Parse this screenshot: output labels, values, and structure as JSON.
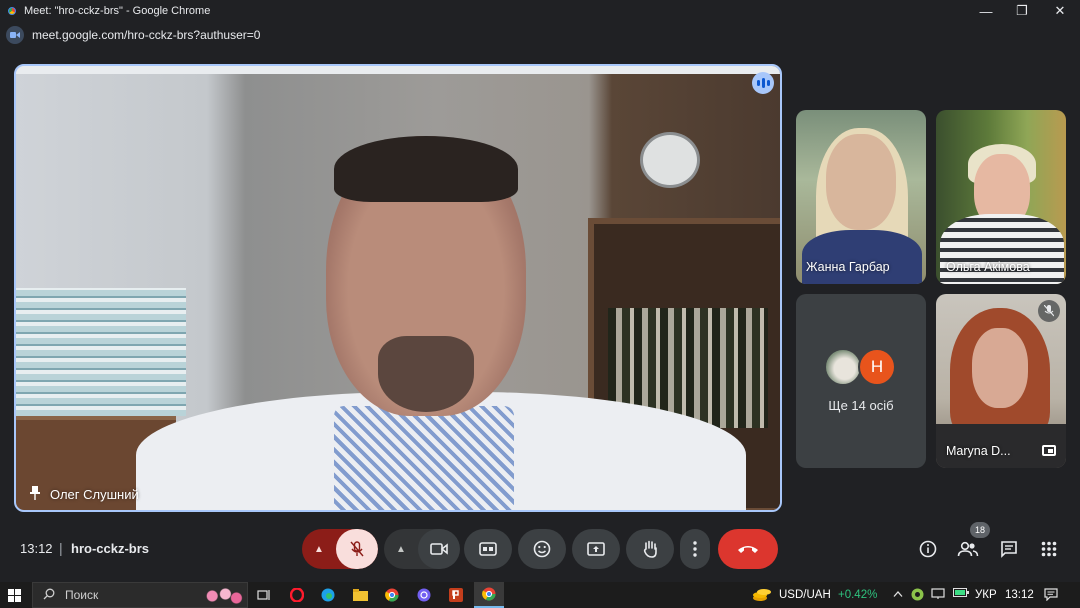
{
  "window": {
    "title": "Meet: \"hro-cckz-brs\" - Google Chrome",
    "minimize": "—",
    "maximize": "❐",
    "close": "✕"
  },
  "address": {
    "url": "meet.google.com/hro-cckz-brs?authuser=0",
    "site_icon": "meet-camera-icon"
  },
  "main_speaker": {
    "name": "Олег Слушний",
    "pinned_icon": "pin-icon",
    "speaking_icon": "audio-level-icon"
  },
  "participants": [
    {
      "name": "Жанна Гарбар"
    },
    {
      "name": "Ольга Акімова"
    },
    {
      "name": "Ще 14 осіб",
      "avatar_letter": "H",
      "avatar_letter_color": "#e8541c"
    },
    {
      "name": "Marуna D...",
      "muted": true
    }
  ],
  "controls": {
    "time": "13:12",
    "separator": "|",
    "meeting_code": "hro-cckz-brs",
    "mic_arrow": "▲",
    "mic_state": "muted",
    "cam_arrow": "▲",
    "people_count": "18",
    "end_color": "#dc362e",
    "mic_color": "#f9dedc"
  },
  "taskbar": {
    "search_placeholder": "Поиск",
    "currency_label": "USD/UAH",
    "currency_change": "+0.42%",
    "language": "УКР",
    "tray_time": "13:12"
  }
}
